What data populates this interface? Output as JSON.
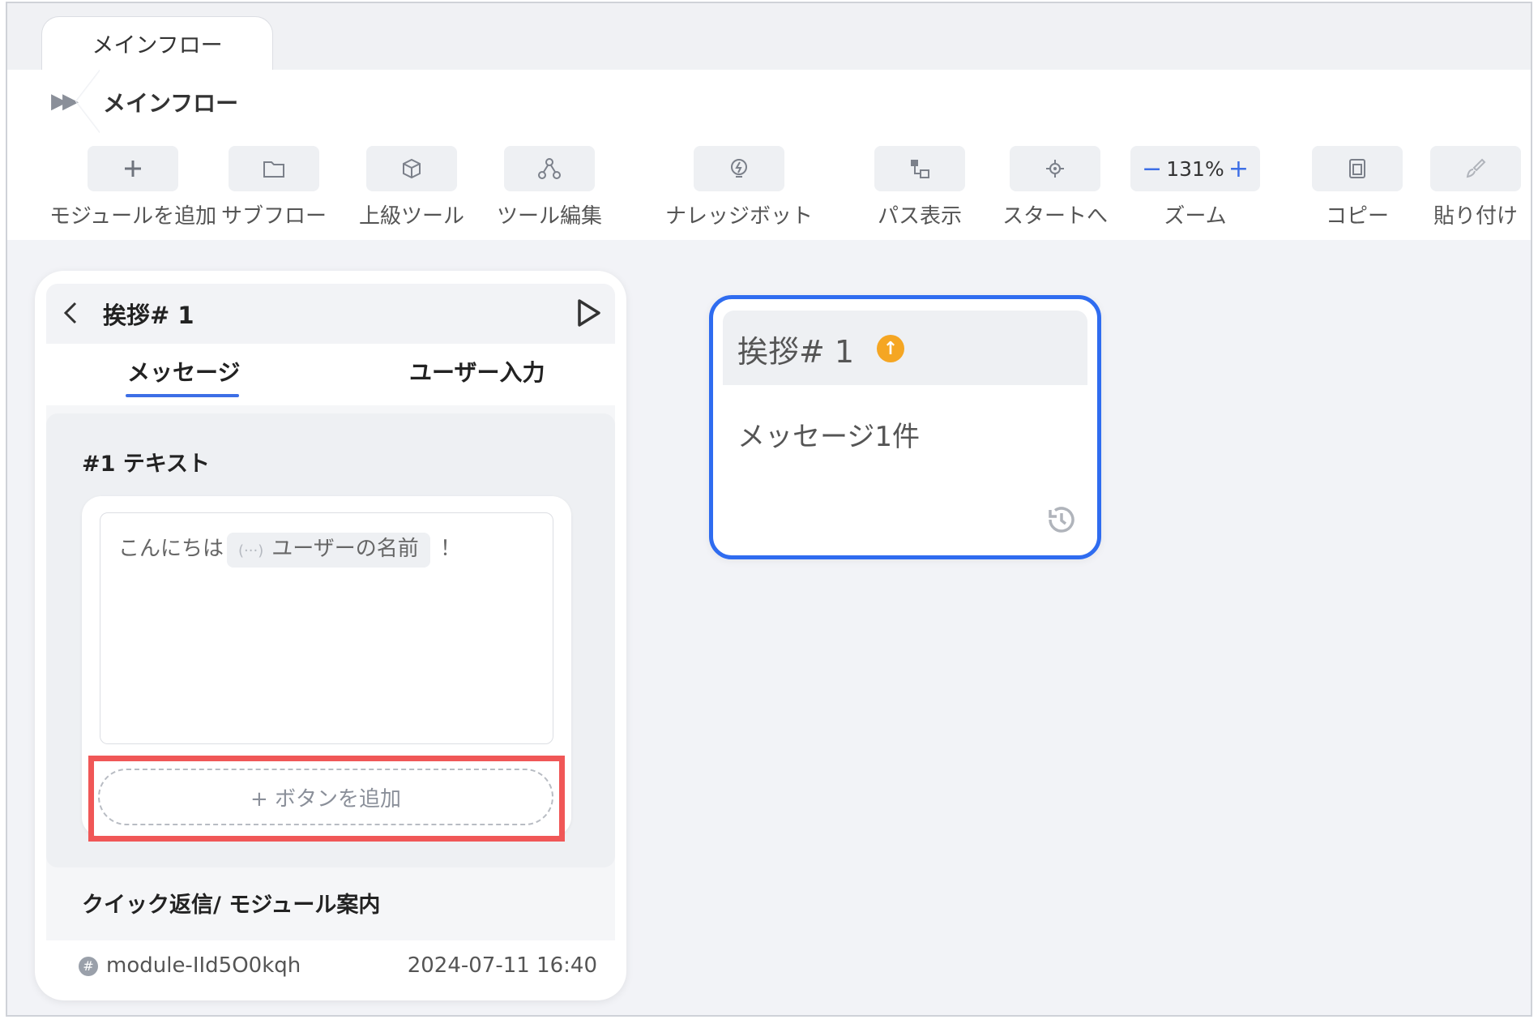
{
  "tab": {
    "label": "メインフロー"
  },
  "breadcrumb": {
    "icon": "double-chevron-right-icon",
    "title": "メインフロー"
  },
  "toolbar": {
    "add_module": "モジュールを追加",
    "subflow": "サブフロー",
    "advanced_tools": "上級ツール",
    "tool_edit": "ツール編集",
    "knowledge_bot": "ナレッジボット",
    "path_view": "パス表示",
    "to_start": "スタートへ",
    "zoom_label": "ズーム",
    "zoom_value": "131%",
    "zoom_minus": "−",
    "zoom_plus": "+",
    "copy": "コピー",
    "paste": "貼り付け"
  },
  "panel": {
    "title": "挨拶# 1",
    "tabs": {
      "message": "メッセージ",
      "user_input": "ユーザー入力"
    },
    "message_label": "#1 テキスト",
    "text_prefix": "こんにちは",
    "variable": "ユーザーの名前",
    "text_suffix": "！",
    "add_button": "+ ボタンを追加",
    "quick_reply_label": "クイック返信/ モジュール案内",
    "module_id": "module-IId5O0kqh",
    "timestamp": "2024-07-11 16:40"
  },
  "node": {
    "title": "挨拶# 1",
    "subtitle": "メッセージ1件"
  },
  "colors": {
    "accent": "#2f6cf0",
    "highlight": "#f05757",
    "badge": "#f5a623"
  }
}
